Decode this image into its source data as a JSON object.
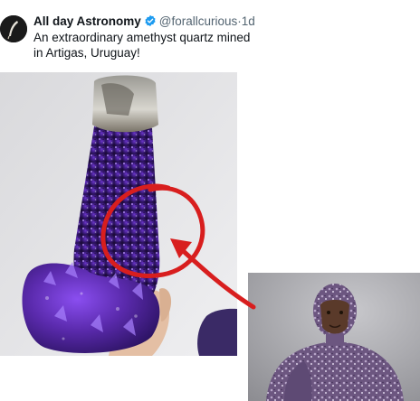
{
  "tweet": {
    "author_name": "All day Astronomy",
    "handle": "@forallcurious",
    "separator": "·",
    "timestamp": "1d",
    "text": "An extraordinary amethyst quartz mined in Artigas, Uruguay!",
    "verified_icon": "verified-badge-icon",
    "accent_color": "#1d9bf0"
  },
  "media": {
    "main_image": "amethyst-geode-photo",
    "inset_image": "crystal-covered-man-photo",
    "annotation_color": "#d81e1e"
  }
}
